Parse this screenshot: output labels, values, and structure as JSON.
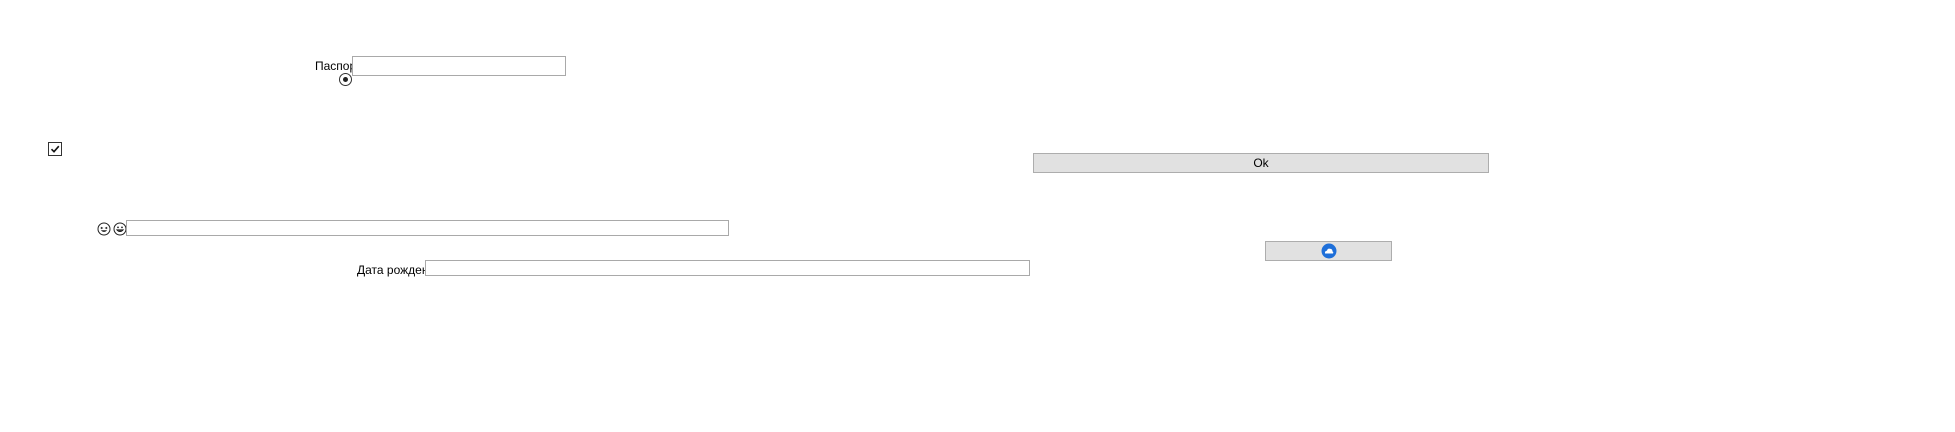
{
  "passport": {
    "label": "Паспорт",
    "value": "",
    "placeholder": ""
  },
  "radio": {
    "checked": true
  },
  "checkbox": {
    "checked": true
  },
  "ok_button": {
    "label": "Ok"
  },
  "emoji_field": {
    "icons": [
      "laughing-face-icon",
      "grinning-face-icon"
    ],
    "value": ""
  },
  "icon_button": {
    "icon": "cloud-badge-icon",
    "accent": "#1e6fd9"
  },
  "birth_date": {
    "label": "Дата рождения",
    "value": ""
  }
}
